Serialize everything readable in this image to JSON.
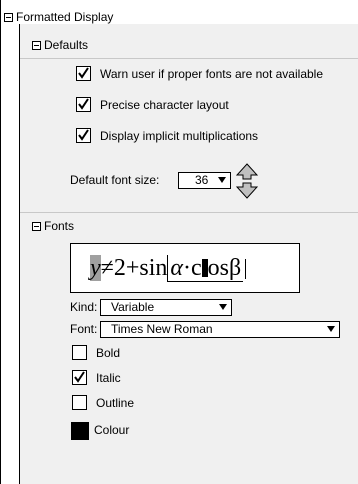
{
  "tree": {
    "root_label": "Formatted Display",
    "defaults": {
      "label": "Defaults",
      "options": [
        {
          "label": "Warn user if proper fonts are not available",
          "checked": true
        },
        {
          "label": "Precise character layout",
          "checked": true
        },
        {
          "label": "Display implicit multiplications",
          "checked": true
        }
      ],
      "font_size_label": "Default font size:",
      "font_size_value": "36"
    },
    "fonts": {
      "label": "Fonts",
      "preview": {
        "y": "y",
        "ne": "≠",
        "two_plus_sin": "2+sin",
        "alpha": "α",
        "cdot": "·",
        "c": "c",
        "rest": "osβ"
      },
      "kind_label": "Kind:",
      "kind_value": "Variable",
      "font_label": "Font:",
      "font_value": "Times New Roman",
      "styles": [
        {
          "label": "Bold",
          "checked": false
        },
        {
          "label": "Italic",
          "checked": true
        },
        {
          "label": "Outline",
          "checked": false
        }
      ],
      "colour_label": "Colour",
      "colour_value": "#000000"
    }
  }
}
